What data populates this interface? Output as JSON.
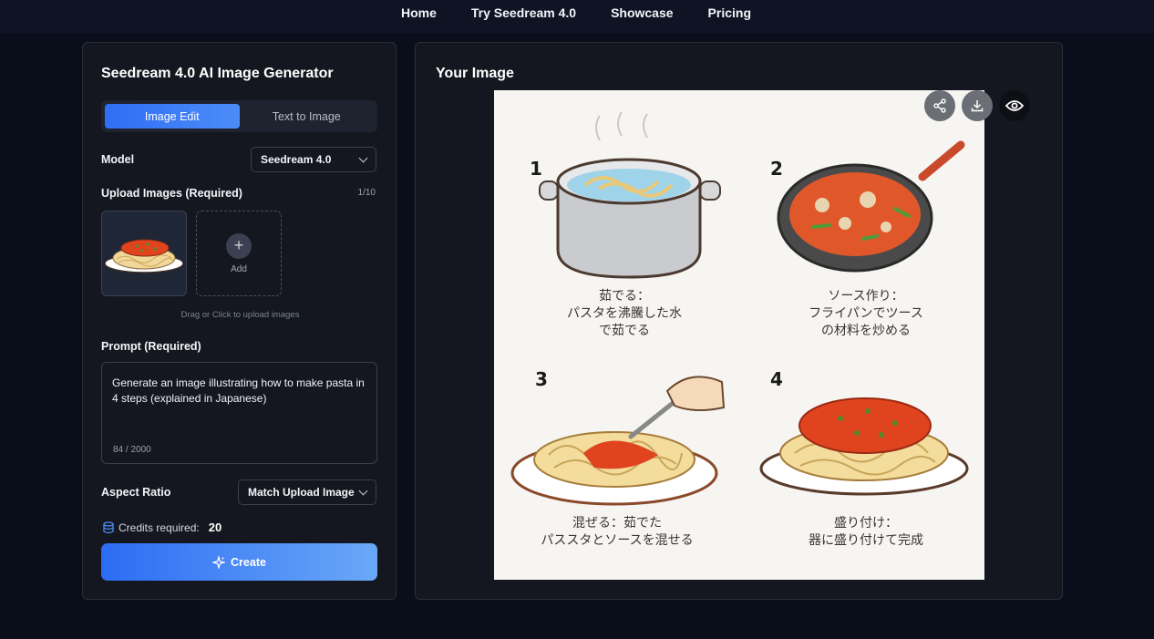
{
  "nav": {
    "items": [
      "Home",
      "Try Seedream 4.0",
      "Showcase",
      "Pricing"
    ]
  },
  "generator": {
    "title": "Seedream 4.0 AI Image Generator",
    "tabs": [
      "Image Edit",
      "Text to Image"
    ],
    "active_tab": "Image Edit",
    "model_label": "Model",
    "model_value": "Seedream 4.0",
    "upload_label": "Upload Images (Required)",
    "upload_count": "1/10",
    "add_label": "Add",
    "upload_hint": "Drag or Click to upload images",
    "prompt_label": "Prompt (Required)",
    "prompt_value": "Generate an image illustrating how to make pasta in 4 steps (explained in Japanese)",
    "prompt_count": "84 / 2000",
    "aspect_label": "Aspect Ratio",
    "aspect_value": "Match Upload Image",
    "credits_label": "Credits required:",
    "credits_value": "20",
    "create_label": "Create"
  },
  "result": {
    "title": "Your Image",
    "steps": [
      {
        "num": "1",
        "line1": "茹でる：",
        "line2": "パスタを沸騰した水",
        "line3": "で茹でる"
      },
      {
        "num": "2",
        "line1": "ソース作り：",
        "line2": "フライパンでツース",
        "line3": "の材料を炒める"
      },
      {
        "num": "3",
        "line1": "混ぜる：茹でた",
        "line2": "パススタとソースを混せる",
        "line3": ""
      },
      {
        "num": "4",
        "line1": "盛り付け：",
        "line2": "器に盛り付けて完成",
        "line3": ""
      }
    ],
    "actions": [
      "share-icon",
      "download-icon",
      "eye-icon"
    ]
  },
  "colors": {
    "accent": "#2f6ef5",
    "background": "#090e1a",
    "panel": "#14171f"
  }
}
